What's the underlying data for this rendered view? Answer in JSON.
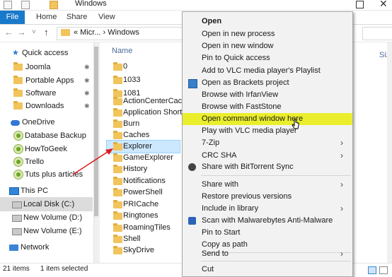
{
  "window": {
    "title": "Windows"
  },
  "ribbon": {
    "file": "File",
    "tabs": [
      "Home",
      "Share",
      "View"
    ]
  },
  "address": {
    "text": "«  Micr...  ›  Windows"
  },
  "nav": {
    "quick_access": "Quick access",
    "items": [
      "Joomla",
      "Portable Apps",
      "Software",
      "Downloads"
    ],
    "onedrive": "OneDrive",
    "onedrive_items": [
      "Database Backup",
      "HowToGeek",
      "Trello",
      "Tuts plus articles"
    ],
    "this_pc": "This PC",
    "drives": [
      "Local Disk (C:)",
      "New Volume (D:)",
      "New Volume (E:)"
    ],
    "network": "Network"
  },
  "list": {
    "header": "Name",
    "items": [
      "0",
      "1033",
      "1081",
      "ActionCenterCache",
      "Application Shortcut",
      "Burn",
      "Caches",
      "Explorer",
      "GameExplorer",
      "History",
      "Notifications",
      "PowerShell",
      "PRICache",
      "Ringtones",
      "RoamingTiles",
      "Shell",
      "SkyDrive"
    ]
  },
  "right_header": "Siz",
  "status": {
    "count": "21 items",
    "selected": "1 item selected"
  },
  "menu": {
    "items": [
      "Open",
      "Open in new process",
      "Open in new window",
      "Pin to Quick access",
      "Add to VLC media player's Playlist",
      "Open as Brackets project",
      "Browse with IrfanView",
      "Browse with FastStone",
      "Open command window here",
      "Play with VLC media player",
      "7-Zip",
      "CRC SHA",
      "Share with BitTorrent Sync",
      "Share with",
      "Restore previous versions",
      "Include in library",
      "Scan with Malwarebytes Anti-Malware",
      "Pin to Start",
      "Copy as path",
      "Send to",
      "Cut"
    ],
    "submenu_arrow": "›",
    "highlight_color": "#eaee2c"
  },
  "icons": {
    "back": "←",
    "forward": "→",
    "down": "˅",
    "up": "↑",
    "close": "✕"
  }
}
